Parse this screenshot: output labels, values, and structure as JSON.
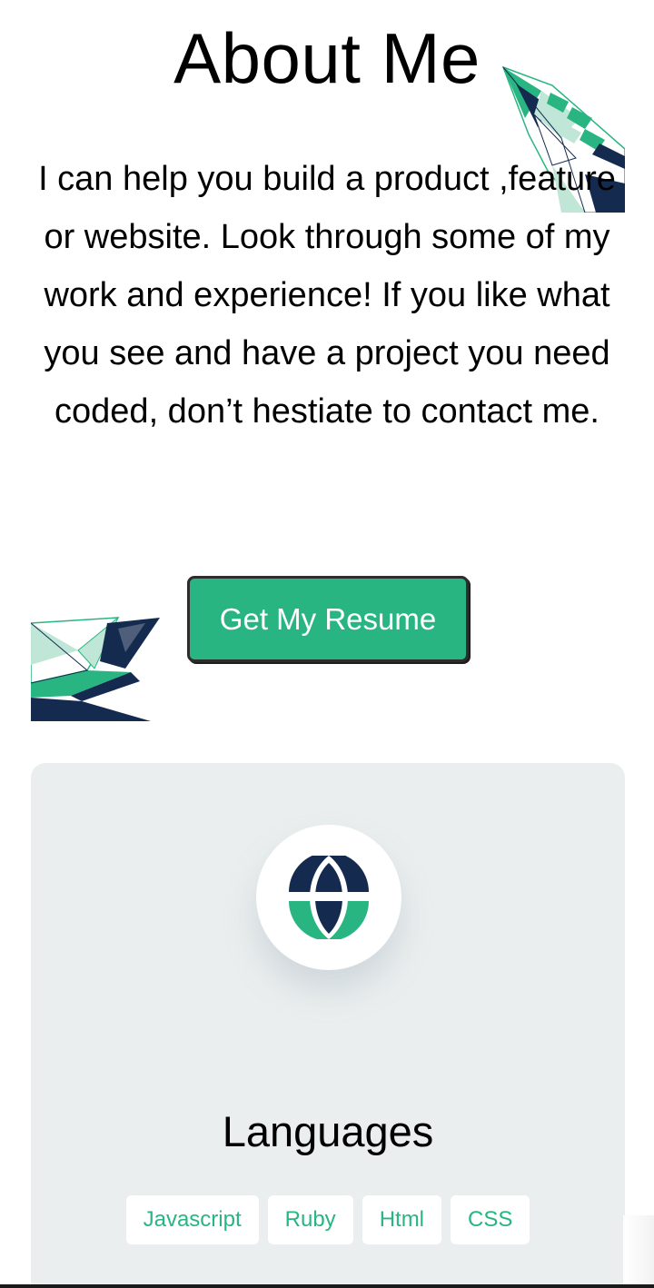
{
  "about": {
    "title": "About Me",
    "paragraph": "I can help you build a product ,feature or website. Look through some of my work and experience! If you like what you see and have a project you need coded, don’t hestiate to contact me.",
    "resume_button_label": "Get My Resume"
  },
  "skills_card": {
    "icon": "globe-icon",
    "title": "Languages",
    "tags": [
      "Javascript",
      "Ruby",
      "Html",
      "CSS"
    ]
  },
  "colors": {
    "accent_green": "#29b582",
    "navy": "#142a4f",
    "card_background": "#eaeeee"
  }
}
